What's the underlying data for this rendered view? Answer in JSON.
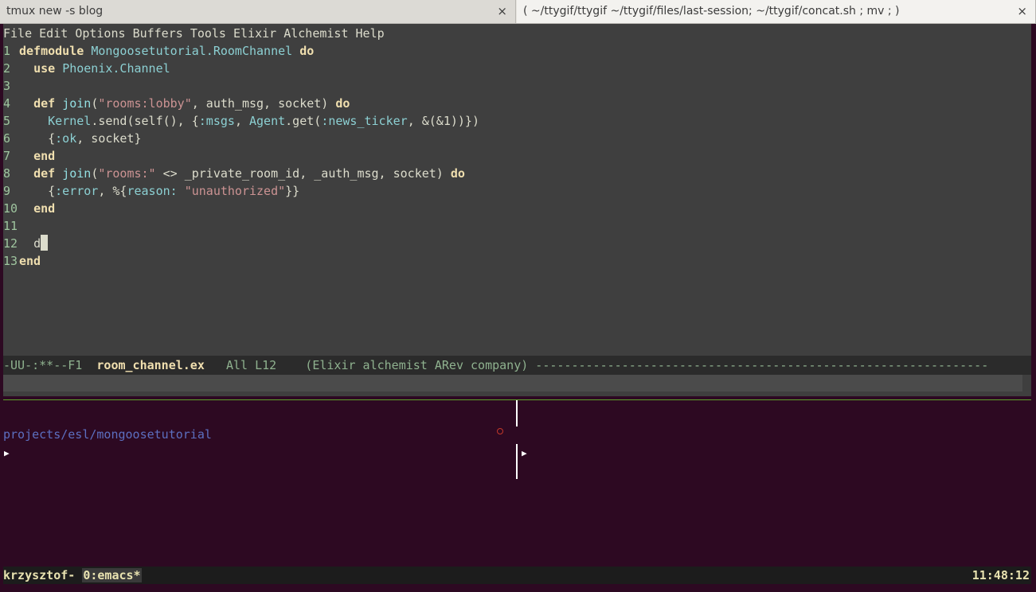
{
  "tabs": [
    {
      "title": "tmux new -s blog",
      "close": "×"
    },
    {
      "title": "( ~/ttygif/ttygif ~/ttygif/files/last-session; ~/ttygif/concat.sh ; mv ; )",
      "close": "×"
    }
  ],
  "menu": [
    "File",
    "Edit",
    "Options",
    "Buffers",
    "Tools",
    "Elixir",
    "Alchemist",
    "Help"
  ],
  "code": {
    "l1": {
      "n": "1",
      "kw": "defmodule",
      "mod": "Mongoosetutorial.RoomChannel",
      "kw2": "do"
    },
    "l2": {
      "n": "2",
      "kw": "use",
      "mod": "Phoenix.Channel"
    },
    "l3": {
      "n": "3"
    },
    "l4": {
      "n": "4",
      "kw": "def",
      "fn": "join",
      "p1": "(",
      "str": "\"rooms:lobby\"",
      "p2": ", auth_msg, socket)",
      "kw2": "do"
    },
    "l5": {
      "n": "5",
      "mod": "Kernel",
      "a": ".send(self(), {",
      "atom1": ":msgs",
      "b": ", ",
      "mod2": "Agent",
      "c": ".get(",
      "atom2": ":news_ticker",
      "d": ", &(&1))})"
    },
    "l6": {
      "n": "6",
      "a": "{",
      "atom": ":ok",
      "b": ", socket}"
    },
    "l7": {
      "n": "7",
      "kw": "end"
    },
    "l8": {
      "n": "8",
      "kw": "def",
      "fn": "join",
      "p1": "(",
      "str": "\"rooms:\"",
      "p2": " <> _private_room_id, _auth_msg, socket)",
      "kw2": "do"
    },
    "l9": {
      "n": "9",
      "a": "{",
      "atom": ":error",
      "b": ", %{",
      "atom2": "reason:",
      "c": " ",
      "str": "\"unauthorized\"",
      "d": "}}"
    },
    "l10": {
      "n": "10",
      "kw": "end"
    },
    "l11": {
      "n": "11"
    },
    "l12": {
      "n": "12",
      "text": "d"
    },
    "l13": {
      "n": "13",
      "kw": "end"
    }
  },
  "modeline": {
    "left": "-UU-:**--F1  ",
    "buffer": "room_channel.ex",
    "right": "   All L12    (Elixir alchemist ARev company) ---------------------------------------------------------------"
  },
  "shell": {
    "path": "projects/esl/mongoosetutorial",
    "prompt": "▶"
  },
  "tmux": {
    "session": "krzysztof- ",
    "window": "0:emacs*",
    "clock": "11:48:12"
  },
  "colors": {
    "emacs_bg": "#3f3f3f",
    "terminal_bg": "#2d0922",
    "divider": "#5fa32a"
  }
}
